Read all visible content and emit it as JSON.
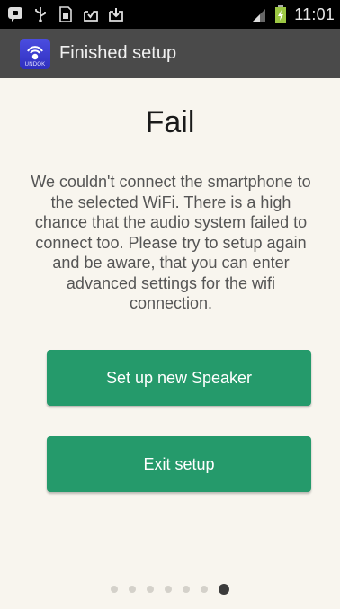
{
  "status_bar": {
    "icons": [
      "chat-notification-icon",
      "usb-icon",
      "sim-card-icon",
      "download-done-icon",
      "download-icon"
    ],
    "right_icons": [
      "signal-icon",
      "battery-icon"
    ],
    "time": "11:01"
  },
  "action_bar": {
    "app_icon_label": "UNDOK",
    "title": "Finished setup"
  },
  "main": {
    "title": "Fail",
    "message": "We couldn't connect the smartphone to the selected WiFi. There is a high chance that the audio system failed to connect too. Please try to setup again and be aware, that you can enter advanced settings for the wifi connection.",
    "buttons": {
      "setup_new_speaker": "Set up new Speaker",
      "exit_setup": "Exit setup"
    }
  },
  "pager": {
    "total": 7,
    "active_index": 6
  },
  "colors": {
    "action_bar": "#4a4a4a",
    "background": "#f8f5ee",
    "button": "#259a6b",
    "app_icon": "#3b3dd4"
  }
}
